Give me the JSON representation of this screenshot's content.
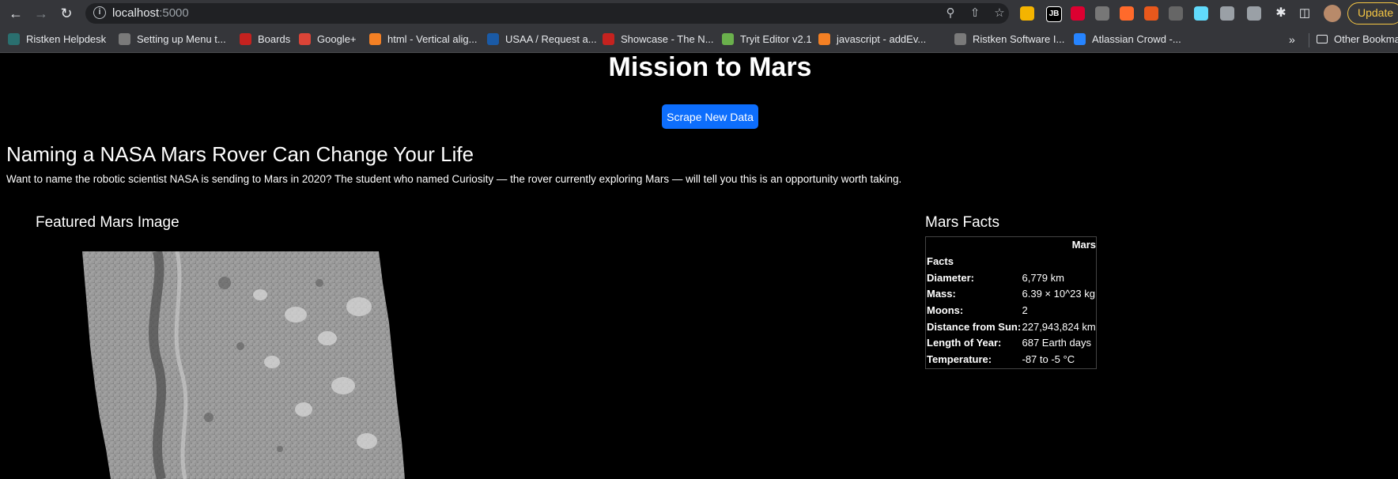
{
  "browser": {
    "url_host": "localhost",
    "url_port": ":5000",
    "update_label": "Update",
    "extensions": [
      {
        "name": "sticky-notes-extension",
        "color": "#f4b400"
      },
      {
        "name": "jb-extension",
        "color": "#000000",
        "text": "JB"
      },
      {
        "name": "angular-devtools-extension",
        "color": "#dd0031"
      },
      {
        "name": "angular-extension",
        "color": "#777777"
      },
      {
        "name": "x-extension",
        "color": "#ff6a2b"
      },
      {
        "name": "rss-extension",
        "color": "#e8581c"
      },
      {
        "name": "cookie-extension",
        "color": "#666666"
      },
      {
        "name": "react-devtools-extension",
        "color": "#61dafb"
      },
      {
        "name": "target-extension",
        "color": "#9aa0a6"
      },
      {
        "name": "eyedropper-extension",
        "color": "#9aa0a6"
      }
    ]
  },
  "bookmarks": [
    {
      "label": "Ristken Helpdesk",
      "color": "#2a6f6f"
    },
    {
      "label": "Setting up Menu t...",
      "color": "#7a7a7a"
    },
    {
      "label": "Boards",
      "color": "#c5221f"
    },
    {
      "label": "Google+",
      "color": "#db4437"
    },
    {
      "label": "html - Vertical alig...",
      "color": "#f48024"
    },
    {
      "label": "USAA / Request a...",
      "color": "#1a5aa6"
    },
    {
      "label": "Showcase - The N...",
      "color": "#c5221f"
    },
    {
      "label": "Tryit Editor v2.1",
      "color": "#6ab04c"
    },
    {
      "label": "javascript - addEv...",
      "color": "#f48024"
    },
    {
      "label": "Ristken Software I...",
      "color": "#7a7a7a"
    },
    {
      "label": "Atlassian Crowd -...",
      "color": "#2684ff"
    }
  ],
  "other_bookmarks": "Other Bookmarks",
  "page": {
    "title": "Mission to Mars",
    "scrape_button": "Scrape New Data",
    "news_title": "Naming a NASA Mars Rover Can Change Your Life",
    "news_paragraph": "Want to name the robotic scientist NASA is sending to Mars in 2020? The student who named Curiosity — the rover currently exploring Mars — will tell you this is an opportunity worth taking.",
    "featured_title": "Featured Mars Image",
    "facts_title": "Mars Facts",
    "facts_header_col": "Mars",
    "facts_header_row": "Facts",
    "facts": [
      {
        "label": "Diameter:",
        "value": "6,779 km"
      },
      {
        "label": "Mass:",
        "value": "6.39 × 10^23 kg"
      },
      {
        "label": "Moons:",
        "value": "2"
      },
      {
        "label": "Distance from Sun:",
        "value": "227,943,824 km"
      },
      {
        "label": "Length of Year:",
        "value": "687 Earth days"
      },
      {
        "label": "Temperature:",
        "value": "-87 to -5 °C"
      }
    ]
  }
}
